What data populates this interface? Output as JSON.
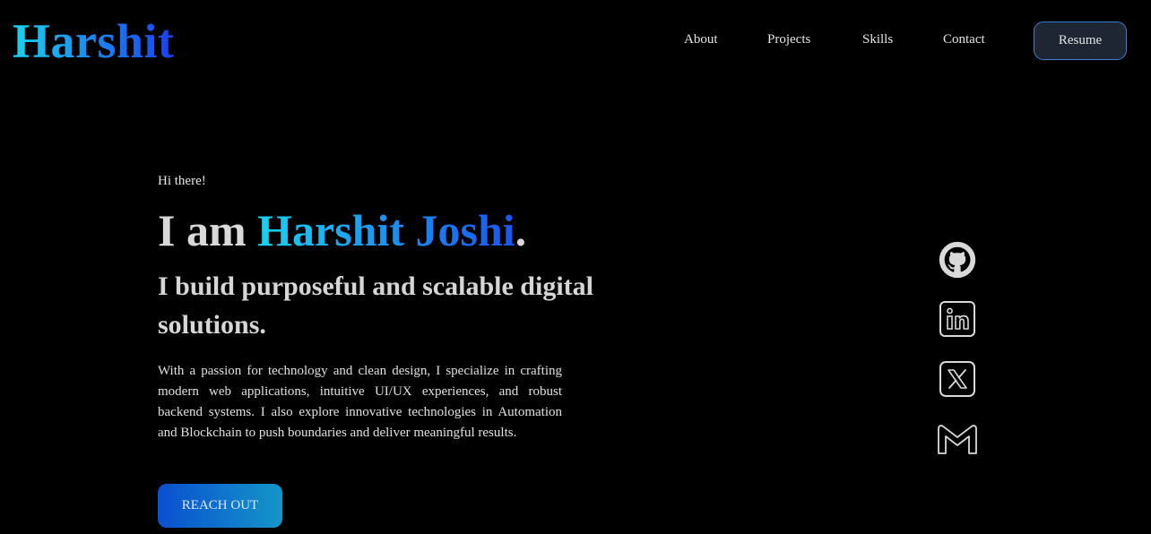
{
  "header": {
    "logo": "Harshit",
    "nav": [
      {
        "label": "About"
      },
      {
        "label": "Projects"
      },
      {
        "label": "Skills"
      },
      {
        "label": "Contact"
      }
    ],
    "resume_label": "Resume"
  },
  "hero": {
    "greeting": "Hi there!",
    "headline_prefix": "I am ",
    "headline_name": "Harshit Joshi",
    "headline_suffix": ".",
    "subhead": "I build purposeful and scalable digital solutions.",
    "description": "With a passion for technology and clean design, I specialize in crafting modern web applications, intuitive UI/UX experiences, and robust backend systems. I also explore innovative technologies in Automation and Blockchain to push boundaries and deliver meaningful results.",
    "cta_label": "REACH OUT"
  },
  "social": [
    {
      "icon": "github-icon"
    },
    {
      "icon": "linkedin-icon"
    },
    {
      "icon": "x-icon"
    },
    {
      "icon": "gmail-icon"
    }
  ],
  "colors": {
    "background": "#000000",
    "accent_start": "#1ad3f0",
    "accent_end": "#1a3ff0",
    "resume_border": "#3a7fd0"
  }
}
